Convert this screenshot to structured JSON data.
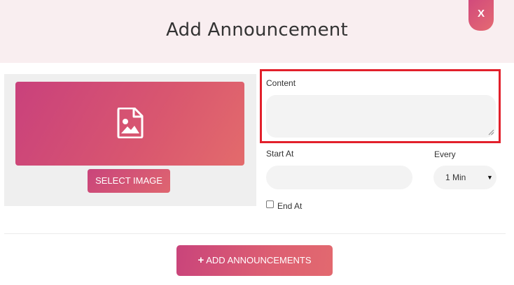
{
  "header": {
    "title": "Add Announcement",
    "close_label": "X"
  },
  "image_panel": {
    "icon": "image-file-icon",
    "select_label": "SELECT IMAGE"
  },
  "content": {
    "label": "Content",
    "value": ""
  },
  "schedule": {
    "start_label": "Start At",
    "start_value": "",
    "every_label": "Every",
    "every_selected": "1 Min",
    "end_label": "End At",
    "end_checked": false
  },
  "footer": {
    "add_icon": "plus-icon",
    "add_label": "ADD ANNOUNCEMENTS"
  },
  "colors": {
    "accent_start": "#c9447b",
    "accent_end": "#e36b6c",
    "header_bg": "#f9eef0",
    "highlight": "#e2202b"
  }
}
